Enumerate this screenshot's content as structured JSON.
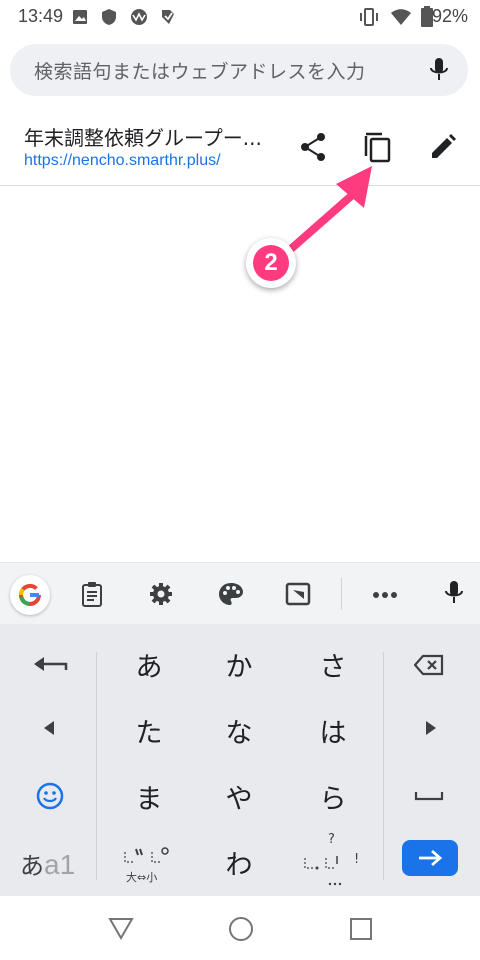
{
  "status_bar": {
    "time": "13:49",
    "battery": "92%"
  },
  "search": {
    "placeholder": "検索語句またはウェブアドレスを入力"
  },
  "suggestion": {
    "title": "年末調整依頼グループー...",
    "url": "https://nencho.smarthr.plus/"
  },
  "annotation": {
    "step": "2"
  },
  "keyboard": {
    "rows": [
      [
        "あ",
        "か",
        "さ"
      ],
      [
        "た",
        "な",
        "は"
      ],
      [
        "ま",
        "や",
        "ら"
      ],
      [
        "",
        "わ",
        ""
      ]
    ],
    "mode_label_a": "あ",
    "mode_label_b": "a1",
    "dakuten_label": "大⇔小",
    "punct_top": "?",
    "punct_bottom": "!",
    "space_symbol": "⎵",
    "enter_symbol": "→"
  },
  "colors": {
    "accent": "#1a73e8",
    "annotation": "#ff3b7f"
  }
}
